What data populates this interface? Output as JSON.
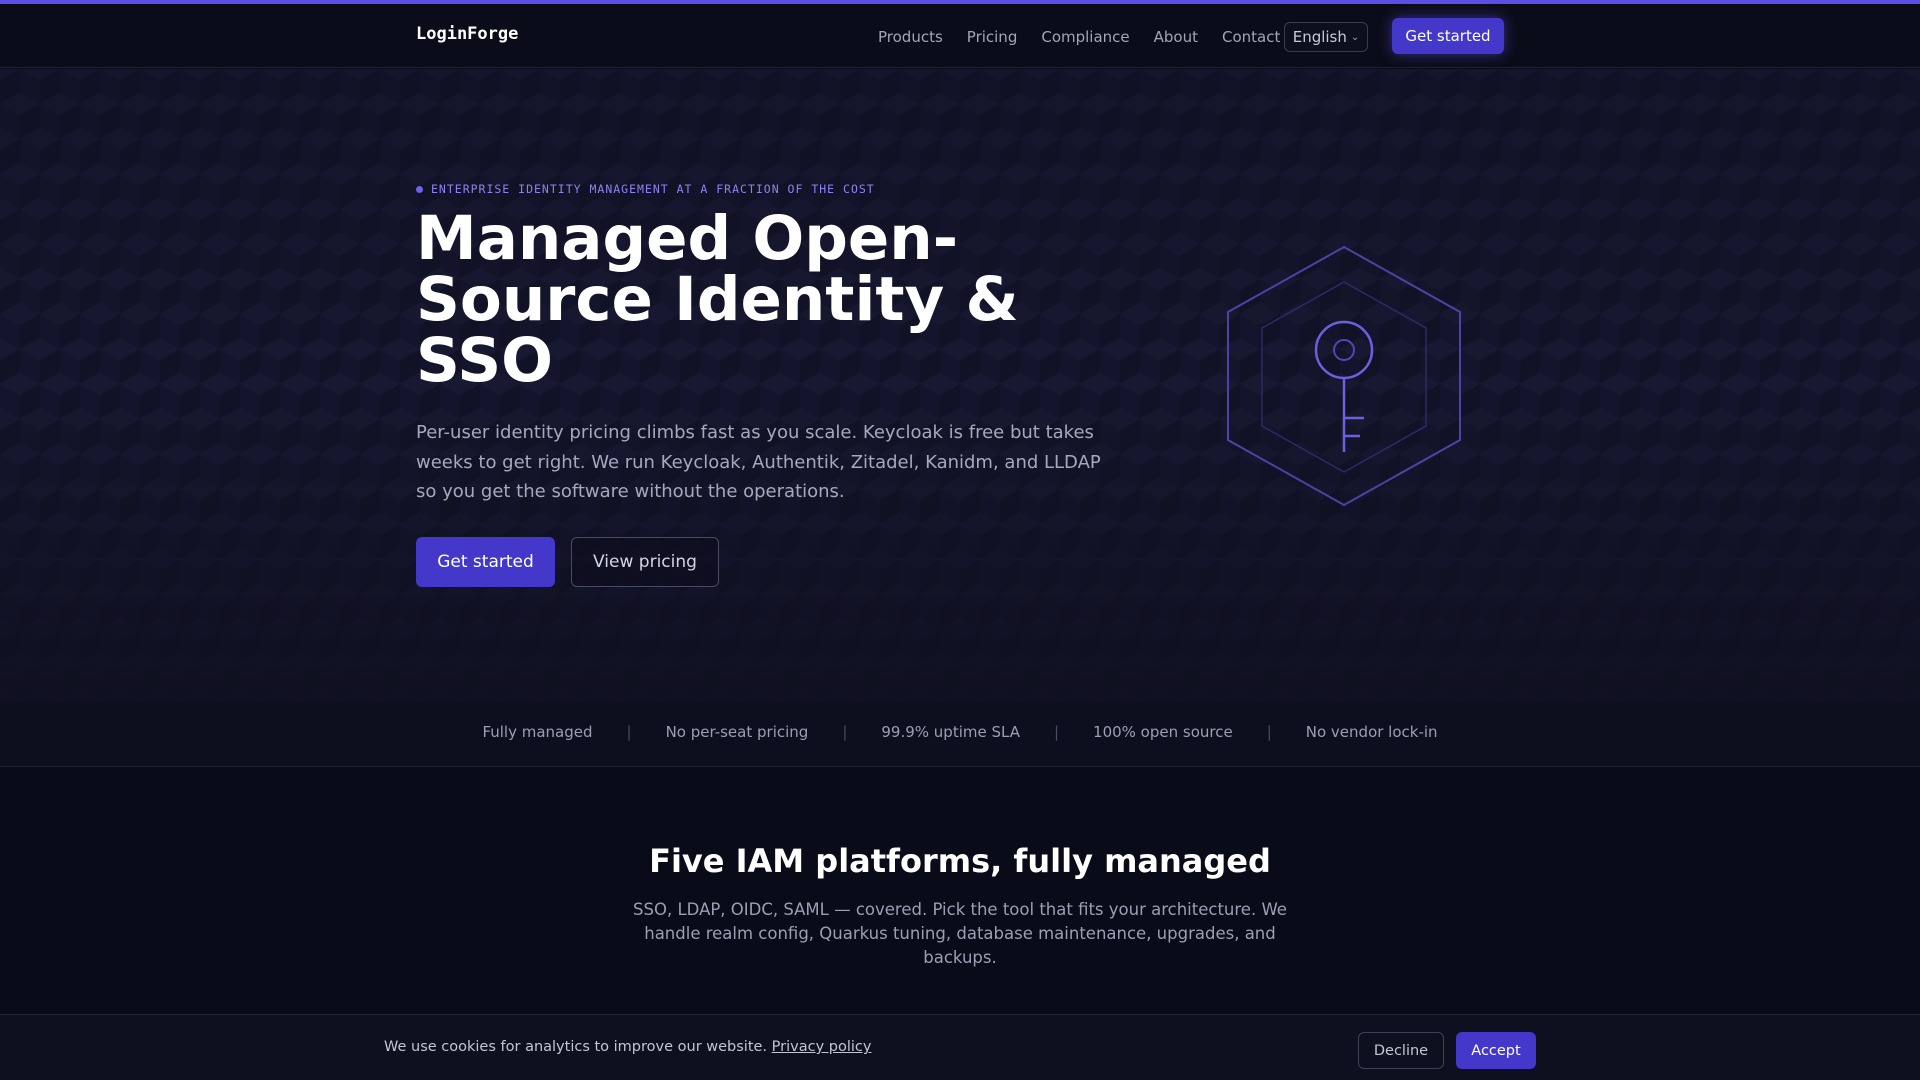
{
  "colors": {
    "accent": "#4338ca",
    "accent_light": "#8b84f0",
    "background": "#0a0b18"
  },
  "navbar": {
    "brand": "LoginForge",
    "links": [
      "Products",
      "Pricing",
      "Compliance",
      "About",
      "Contact"
    ],
    "language": "English",
    "cta_label": "Get started"
  },
  "hero": {
    "eyebrow": "ENTERPRISE IDENTITY MANAGEMENT AT A FRACTION OF THE COST",
    "title_lines": [
      "Managed Open-",
      "Source Identity &",
      "SSO"
    ],
    "subtitle": "Per-user identity pricing climbs fast as you scale. Keycloak is free but takes weeks to get right. We run Keycloak, Authentik, Zitadel, Kanidm, and LLDAP so you get the software without the operations.",
    "primary_button": "Get started",
    "secondary_button": "View pricing",
    "graphic_icon": "key-hexagon-icon"
  },
  "trust_bar": {
    "items": [
      "Fully managed",
      "No per-seat pricing",
      "99.9% uptime SLA",
      "100% open source",
      "No vendor lock-in"
    ],
    "separator": "|"
  },
  "platforms_section": {
    "title": "Five IAM platforms, fully managed",
    "subtitle": "SSO, LDAP, OIDC, SAML — covered. Pick the tool that fits your architecture. We handle realm config, Quarkus tuning, database maintenance, upgrades, and backups."
  },
  "cookie_banner": {
    "text": "We use cookies for analytics to improve our website.",
    "link_text": "Privacy policy",
    "decline_label": "Decline",
    "accept_label": "Accept"
  }
}
